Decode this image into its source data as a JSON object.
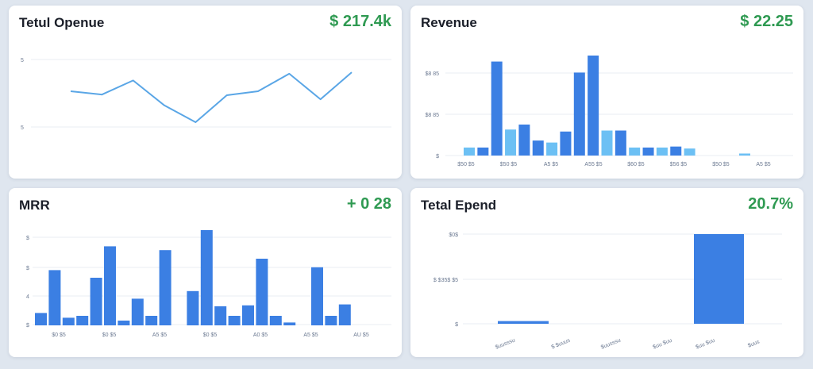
{
  "colors": {
    "accent_blue": "#3b7fe3",
    "light_blue": "#6cc0f4",
    "line_blue": "#5aa6e6",
    "metric_green": "#2f9a52"
  },
  "cards": [
    {
      "title": "Tetul Openue",
      "metric": "$ 217.4k"
    },
    {
      "title": "Revenue",
      "metric": "$ 22.25"
    },
    {
      "title": "MRR",
      "metric": "+ 0 28"
    },
    {
      "title": "Tetal Epend",
      "metric": "20.7%"
    }
  ],
  "chart_data": [
    {
      "type": "line",
      "y_ticks": [
        "5",
        "5"
      ],
      "grid": true,
      "series": [
        {
          "values": [
            0.53,
            0.48,
            0.69,
            0.32,
            0.07,
            0.47,
            0.53,
            0.79,
            0.41,
            0.81
          ]
        }
      ]
    },
    {
      "type": "bar",
      "y_ticks": [
        "$8 85",
        "$8 85",
        "$"
      ],
      "x_ticks": [
        "$50 $5",
        "$50 $5",
        "A5 $5",
        "A55 $5",
        "$60 $5",
        "$56 $5",
        "$50 $5",
        "A5 $5"
      ],
      "grid": true,
      "series": [
        {
          "values": [
            {
              "v": 0.08,
              "light": true
            },
            {
              "v": 0.08,
              "light": false
            },
            {
              "v": 0.94,
              "light": false
            },
            {
              "v": 0.26,
              "light": true
            },
            {
              "v": 0.31,
              "light": false
            },
            {
              "v": 0.15,
              "light": false
            },
            {
              "v": 0.13,
              "light": true
            },
            {
              "v": 0.24,
              "light": false
            },
            {
              "v": 0.83,
              "light": false
            },
            {
              "v": 1.0,
              "light": false
            },
            {
              "v": 0.25,
              "light": true
            },
            {
              "v": 0.25,
              "light": false
            },
            {
              "v": 0.08,
              "light": true
            },
            {
              "v": 0.08,
              "light": false
            },
            {
              "v": 0.08,
              "light": true
            },
            {
              "v": 0.09,
              "light": false
            },
            {
              "v": 0.07,
              "light": true
            },
            {
              "v": 0.0,
              "light": false
            },
            {
              "v": 0.0,
              "light": false
            },
            {
              "v": 0.0,
              "light": false
            },
            {
              "v": 0.02,
              "light": true
            }
          ]
        }
      ]
    },
    {
      "type": "bar",
      "y_ticks": [
        "$",
        "$",
        "4",
        "$"
      ],
      "x_ticks": [
        "$0 $5",
        "$0 $5",
        "A5 $5",
        "$0 $5",
        "A0 $5",
        "A5 $5",
        "AU $5"
      ],
      "grid": true,
      "series": [
        {
          "values": [
            0.13,
            0.58,
            0.08,
            0.1,
            0.5,
            0.83,
            0.05,
            0.28,
            0.1,
            0.79,
            0.0,
            0.36,
            1.0,
            0.2,
            0.1,
            0.21,
            0.7,
            0.1,
            0.03,
            0.0,
            0.61,
            0.1,
            0.22
          ]
        }
      ]
    },
    {
      "type": "bar",
      "y_ticks": [
        "$0$",
        "$ $35$ $5",
        "$"
      ],
      "x_ticks": [
        "$uusssu",
        "$ $uuus",
        "$uusssu",
        "$uu $uu",
        "$uu $uu",
        "$uus"
      ],
      "grid": true,
      "series": [
        {
          "values": [
            0.03,
            0.0,
            0.0,
            0.0,
            1.0,
            0.0
          ]
        }
      ]
    }
  ]
}
